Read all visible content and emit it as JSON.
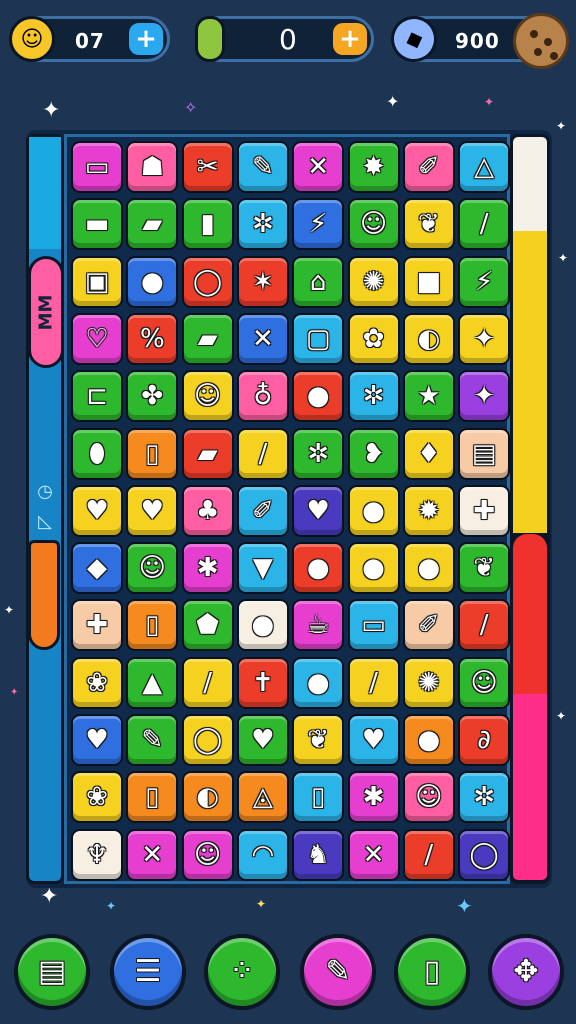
{
  "hud": {
    "left": {
      "value": "07",
      "icon": "smiley-face-icon",
      "action": "+"
    },
    "center": {
      "value": "0",
      "icon": "pickle-icon",
      "action": "+"
    },
    "right": {
      "value": "900",
      "icon": "crystal-icon",
      "badge_icon": "cookie-icon"
    }
  },
  "sidebar": {
    "label": "MM"
  },
  "colors": {
    "background": "#1d3553",
    "magenta": "#e63fd0",
    "pink": "#ff5fa2",
    "red": "#ec3d2a",
    "cyan": "#2ab4e8",
    "green": "#2eb82e",
    "yellow": "#f5d21f",
    "orange": "#f58a1f",
    "blue": "#2f6fe0",
    "purple": "#9a3fe0",
    "indigo": "#4a3ac0",
    "peach": "#f8cba7",
    "cream": "#f7efe2"
  },
  "board": {
    "rows": 13,
    "cols": 8,
    "tiles": [
      [
        [
          "magenta",
          "▭"
        ],
        [
          "pink",
          "☗"
        ],
        [
          "red",
          "✂"
        ],
        [
          "cyan",
          "✎"
        ],
        [
          "magenta",
          "✕"
        ],
        [
          "green",
          "✸"
        ],
        [
          "pink",
          "✐"
        ],
        [
          "cyan",
          "△"
        ]
      ],
      [
        [
          "green",
          "▬"
        ],
        [
          "green",
          "▰"
        ],
        [
          "green",
          "▮"
        ],
        [
          "cyan",
          "✲"
        ],
        [
          "blue",
          "⚡"
        ],
        [
          "green",
          "☺"
        ],
        [
          "yellow",
          "❦"
        ],
        [
          "green",
          "/"
        ]
      ],
      [
        [
          "yellow",
          "▣"
        ],
        [
          "blue",
          "●"
        ],
        [
          "red",
          "◯"
        ],
        [
          "red",
          "✶"
        ],
        [
          "green",
          "⌂"
        ],
        [
          "yellow",
          "✺"
        ],
        [
          "yellow",
          "■"
        ],
        [
          "green",
          "⚡"
        ]
      ],
      [
        [
          "magenta",
          "♡"
        ],
        [
          "red",
          "%"
        ],
        [
          "green",
          "▰"
        ],
        [
          "blue",
          "✕"
        ],
        [
          "cyan",
          "▢"
        ],
        [
          "yellow",
          "✿"
        ],
        [
          "yellow",
          "◐"
        ],
        [
          "yellow",
          "✦"
        ]
      ],
      [
        [
          "green",
          "⊏"
        ],
        [
          "green",
          "✤"
        ],
        [
          "yellow",
          "☺"
        ],
        [
          "pink",
          "♁"
        ],
        [
          "red",
          "●"
        ],
        [
          "cyan",
          "✲"
        ],
        [
          "green",
          "★"
        ],
        [
          "purple",
          "✦"
        ]
      ],
      [
        [
          "green",
          "⬮"
        ],
        [
          "orange",
          "▯"
        ],
        [
          "red",
          "▰"
        ],
        [
          "yellow",
          "/"
        ],
        [
          "green",
          "✲"
        ],
        [
          "green",
          "❥"
        ],
        [
          "yellow",
          "♦"
        ],
        [
          "peach",
          "▤"
        ]
      ],
      [
        [
          "yellow",
          "♥"
        ],
        [
          "yellow",
          "♥"
        ],
        [
          "pink",
          "♣"
        ],
        [
          "cyan",
          "✐"
        ],
        [
          "indigo",
          "♥"
        ],
        [
          "yellow",
          "●"
        ],
        [
          "yellow",
          "✹"
        ],
        [
          "cream",
          "✚"
        ]
      ],
      [
        [
          "blue",
          "◆"
        ],
        [
          "green",
          "☺"
        ],
        [
          "magenta",
          "✱"
        ],
        [
          "cyan",
          "▼"
        ],
        [
          "red",
          "●"
        ],
        [
          "yellow",
          "●"
        ],
        [
          "yellow",
          "●"
        ],
        [
          "green",
          "❦"
        ]
      ],
      [
        [
          "peach",
          "✚"
        ],
        [
          "orange",
          "▯"
        ],
        [
          "green",
          "⬟"
        ],
        [
          "cream",
          "●"
        ],
        [
          "magenta",
          "☕"
        ],
        [
          "cyan",
          "▭"
        ],
        [
          "peach",
          "✐"
        ],
        [
          "red",
          "/"
        ]
      ],
      [
        [
          "yellow",
          "❀"
        ],
        [
          "green",
          "▲"
        ],
        [
          "yellow",
          "/"
        ],
        [
          "red",
          "✝"
        ],
        [
          "cyan",
          "●"
        ],
        [
          "yellow",
          "/"
        ],
        [
          "yellow",
          "✺"
        ],
        [
          "green",
          "☺"
        ]
      ],
      [
        [
          "blue",
          "♥"
        ],
        [
          "green",
          "✎"
        ],
        [
          "yellow",
          "◯"
        ],
        [
          "green",
          "♥"
        ],
        [
          "yellow",
          "❦"
        ],
        [
          "cyan",
          "♥"
        ],
        [
          "orange",
          "●"
        ],
        [
          "red",
          "∂"
        ]
      ],
      [
        [
          "yellow",
          "❀"
        ],
        [
          "orange",
          "▯"
        ],
        [
          "orange",
          "◐"
        ],
        [
          "orange",
          "◬"
        ],
        [
          "cyan",
          "▯"
        ],
        [
          "magenta",
          "✱"
        ],
        [
          "pink",
          "☺"
        ],
        [
          "cyan",
          "✲"
        ]
      ],
      [
        [
          "cream",
          "♆"
        ],
        [
          "magenta",
          "✕"
        ],
        [
          "magenta",
          "☺"
        ],
        [
          "cyan",
          "◠"
        ],
        [
          "indigo",
          "♞"
        ],
        [
          "magenta",
          "✕"
        ],
        [
          "red",
          "/"
        ],
        [
          "indigo",
          "◯"
        ]
      ]
    ]
  },
  "bottom_bar": [
    {
      "icon": "menu-book-icon",
      "glyph": "▤",
      "color": "green"
    },
    {
      "icon": "list-icon",
      "glyph": "☰",
      "color": "blue"
    },
    {
      "icon": "dots-icon",
      "glyph": "⁘",
      "color": "green"
    },
    {
      "icon": "pencil-icon",
      "glyph": "✎",
      "color": "magenta"
    },
    {
      "icon": "card-icon",
      "glyph": "▯",
      "color": "green"
    },
    {
      "icon": "puzzle-icon",
      "glyph": "✥",
      "color": "purple"
    }
  ]
}
